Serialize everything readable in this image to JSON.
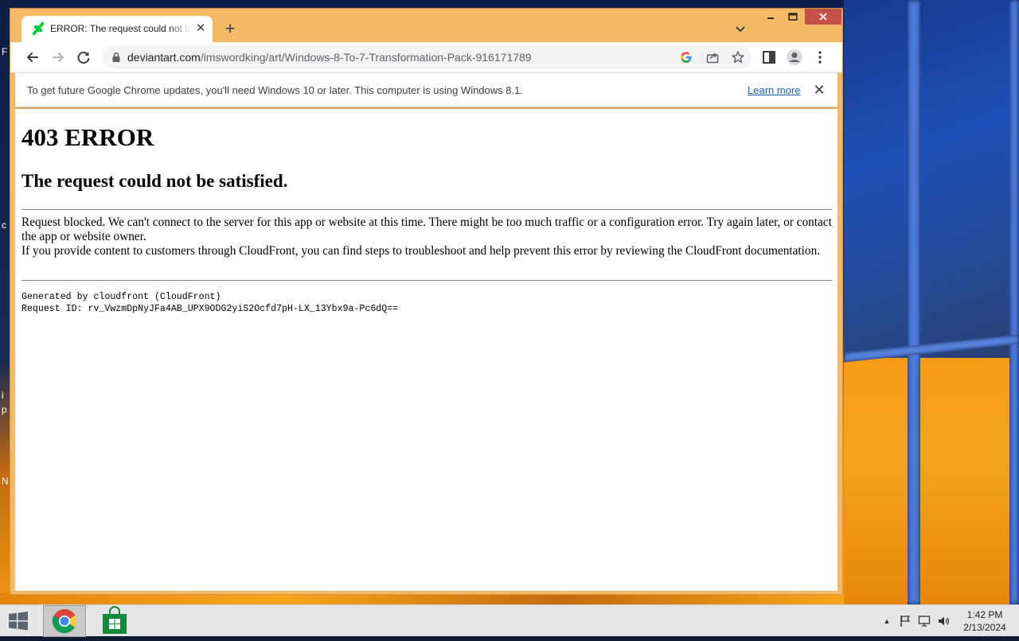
{
  "desktop": {
    "edge_glyphs": [
      "F",
      "c",
      "i",
      "p",
      "N"
    ]
  },
  "tab": {
    "title": "ERROR: The request could not be satisfied",
    "close_glyph": "✕"
  },
  "newtab": {
    "glyph": "+"
  },
  "window_controls": {
    "minimize": "‒",
    "maximize": "▢",
    "close": "✕"
  },
  "omnibox": {
    "host": "deviantart.com",
    "path": "/imswordking/art/Windows-8-To-7-Transformation-Pack-916171789"
  },
  "infobar": {
    "message": "To get future Google Chrome updates, you'll need Windows 10 or later. This computer is using Windows 8.1.",
    "link": "Learn more",
    "close_glyph": "✕"
  },
  "page": {
    "heading": "403 ERROR",
    "subheading": "The request could not be satisfied.",
    "paragraph1": "Request blocked. We can't connect to the server for this app or website at this time. There might be too much traffic or a configuration error. Try again later, or contact the app or website owner.",
    "paragraph2": "If you provide content to customers through CloudFront, you can find steps to troubleshoot and help prevent this error by reviewing the CloudFront documentation.",
    "generated_by": "Generated by cloudfront (CloudFront)",
    "request_id": "Request ID: rv_VwzmDpNyJFa4AB_UPX9ODG2yiS2Ocfd7pH-LX_13Ybx9a-Pc6dQ=="
  },
  "taskbar": {
    "clock_time": "1:42 PM",
    "clock_date": "2/13/2024",
    "tray_expand_glyph": "▲"
  },
  "colors": {
    "window_frame": "#f4b967",
    "close_button": "#c7504a",
    "link": "#1a5fb4",
    "taskbar": "#e6e6e6"
  }
}
